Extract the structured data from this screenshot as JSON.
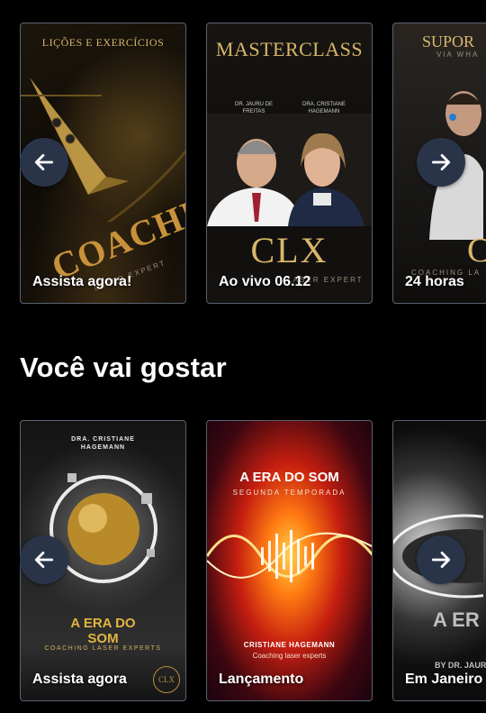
{
  "row1": {
    "cards": [
      {
        "title": "LIÇÕES E EXERCÍCIOS",
        "logo_text": "COACHING",
        "subtitle": "LASER EXPERT",
        "label": "Assista agora!"
      },
      {
        "title": "MASTERCLASS",
        "speaker1": "DR. JAURU DE FREITAS",
        "speaker2": "DRA. CRISTIANE HAGEMANN",
        "brand": "CLX",
        "brand_sub": "LASER EXPERT",
        "label": "Ao vivo 06.12"
      },
      {
        "title": "SUPOR",
        "subtitle": "VIA WHA",
        "brand": "CL",
        "brand_sub": "COACHING LA",
        "label": "24 horas"
      }
    ],
    "prev_icon": "arrow-left-icon",
    "next_icon": "arrow-right-icon"
  },
  "section": {
    "title": "Você vai gostar"
  },
  "row2": {
    "cards": [
      {
        "top": "DRA. CRISTIANE HAGEMANN",
        "title": "A ERA DO SOM",
        "brand": "CLX",
        "brand_sub": "COACHING LASER EXPERTS",
        "label": "Assista agora"
      },
      {
        "title": "A ERA DO SOM",
        "subtitle": "SEGUNDA TEMPORADA",
        "name": "CRISTIANE HAGEMANN",
        "sub": "Coaching laser experts",
        "label": "Lançamento"
      },
      {
        "title": "A ER",
        "by": "BY DR. JAURU",
        "label": "Em Janeiro"
      }
    ],
    "prev_icon": "arrow-left-icon",
    "next_icon": "arrow-right-icon"
  },
  "colors": {
    "nav_button": "#2a3449",
    "card_border": "#5a6272",
    "gold": "#d9b66a"
  }
}
